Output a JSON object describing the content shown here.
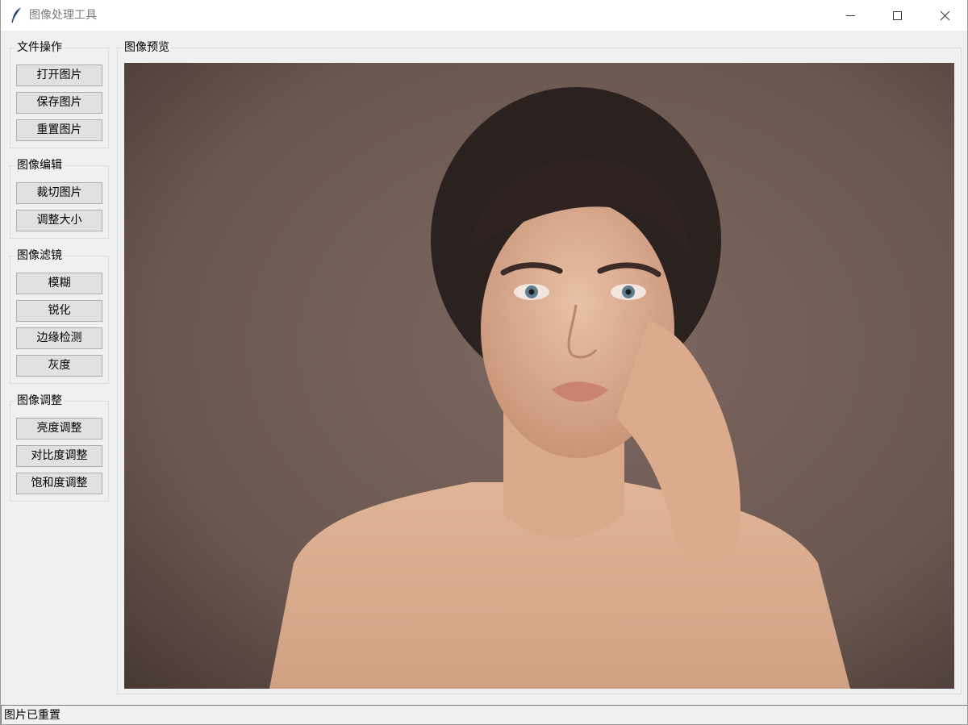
{
  "window": {
    "title": "图像处理工具",
    "app_icon": "feather-icon",
    "controls": [
      "minimize-icon",
      "maximize-icon",
      "close-icon"
    ]
  },
  "sidebar": {
    "groups": [
      {
        "title": "文件操作",
        "buttons": [
          "打开图片",
          "保存图片",
          "重置图片"
        ]
      },
      {
        "title": "图像编辑",
        "buttons": [
          "裁切图片",
          "调整大小"
        ]
      },
      {
        "title": "图像滤镜",
        "buttons": [
          "模糊",
          "锐化",
          "边缘检测",
          "灰度"
        ]
      },
      {
        "title": "图像调整",
        "buttons": [
          "亮度调整",
          "对比度调整",
          "饱和度调整"
        ]
      }
    ]
  },
  "preview": {
    "title": "图像预览"
  },
  "status": {
    "text": "图片已重置"
  },
  "colors": {
    "window_bg": "#f0f0f0",
    "button_bg": "#e1e1e1",
    "photo_bg": "#6e5a52"
  }
}
